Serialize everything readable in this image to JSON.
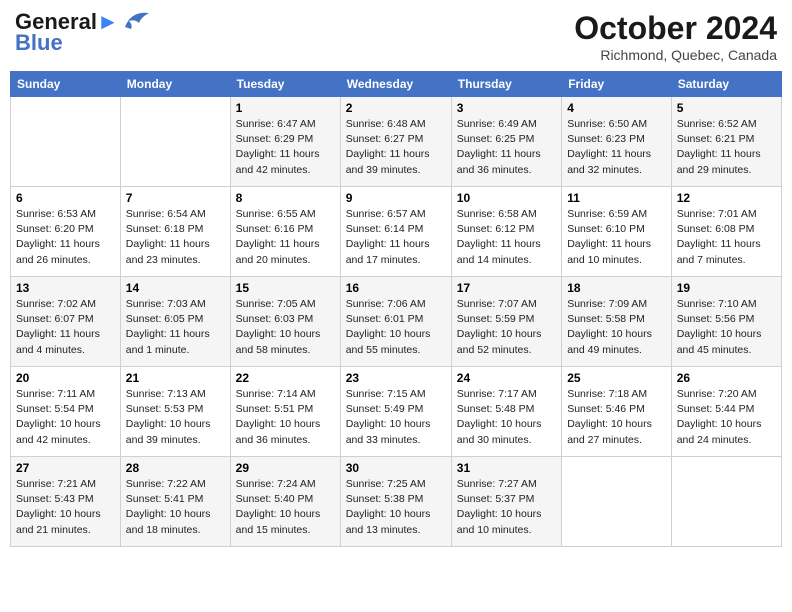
{
  "header": {
    "logo_line1": "General",
    "logo_line2": "Blue",
    "month": "October 2024",
    "location": "Richmond, Quebec, Canada"
  },
  "weekdays": [
    "Sunday",
    "Monday",
    "Tuesday",
    "Wednesday",
    "Thursday",
    "Friday",
    "Saturday"
  ],
  "weeks": [
    [
      {
        "day": "",
        "sunrise": "",
        "sunset": "",
        "daylight": ""
      },
      {
        "day": "",
        "sunrise": "",
        "sunset": "",
        "daylight": ""
      },
      {
        "day": "1",
        "sunrise": "Sunrise: 6:47 AM",
        "sunset": "Sunset: 6:29 PM",
        "daylight": "Daylight: 11 hours and 42 minutes."
      },
      {
        "day": "2",
        "sunrise": "Sunrise: 6:48 AM",
        "sunset": "Sunset: 6:27 PM",
        "daylight": "Daylight: 11 hours and 39 minutes."
      },
      {
        "day": "3",
        "sunrise": "Sunrise: 6:49 AM",
        "sunset": "Sunset: 6:25 PM",
        "daylight": "Daylight: 11 hours and 36 minutes."
      },
      {
        "day": "4",
        "sunrise": "Sunrise: 6:50 AM",
        "sunset": "Sunset: 6:23 PM",
        "daylight": "Daylight: 11 hours and 32 minutes."
      },
      {
        "day": "5",
        "sunrise": "Sunrise: 6:52 AM",
        "sunset": "Sunset: 6:21 PM",
        "daylight": "Daylight: 11 hours and 29 minutes."
      }
    ],
    [
      {
        "day": "6",
        "sunrise": "Sunrise: 6:53 AM",
        "sunset": "Sunset: 6:20 PM",
        "daylight": "Daylight: 11 hours and 26 minutes."
      },
      {
        "day": "7",
        "sunrise": "Sunrise: 6:54 AM",
        "sunset": "Sunset: 6:18 PM",
        "daylight": "Daylight: 11 hours and 23 minutes."
      },
      {
        "day": "8",
        "sunrise": "Sunrise: 6:55 AM",
        "sunset": "Sunset: 6:16 PM",
        "daylight": "Daylight: 11 hours and 20 minutes."
      },
      {
        "day": "9",
        "sunrise": "Sunrise: 6:57 AM",
        "sunset": "Sunset: 6:14 PM",
        "daylight": "Daylight: 11 hours and 17 minutes."
      },
      {
        "day": "10",
        "sunrise": "Sunrise: 6:58 AM",
        "sunset": "Sunset: 6:12 PM",
        "daylight": "Daylight: 11 hours and 14 minutes."
      },
      {
        "day": "11",
        "sunrise": "Sunrise: 6:59 AM",
        "sunset": "Sunset: 6:10 PM",
        "daylight": "Daylight: 11 hours and 10 minutes."
      },
      {
        "day": "12",
        "sunrise": "Sunrise: 7:01 AM",
        "sunset": "Sunset: 6:08 PM",
        "daylight": "Daylight: 11 hours and 7 minutes."
      }
    ],
    [
      {
        "day": "13",
        "sunrise": "Sunrise: 7:02 AM",
        "sunset": "Sunset: 6:07 PM",
        "daylight": "Daylight: 11 hours and 4 minutes."
      },
      {
        "day": "14",
        "sunrise": "Sunrise: 7:03 AM",
        "sunset": "Sunset: 6:05 PM",
        "daylight": "Daylight: 11 hours and 1 minute."
      },
      {
        "day": "15",
        "sunrise": "Sunrise: 7:05 AM",
        "sunset": "Sunset: 6:03 PM",
        "daylight": "Daylight: 10 hours and 58 minutes."
      },
      {
        "day": "16",
        "sunrise": "Sunrise: 7:06 AM",
        "sunset": "Sunset: 6:01 PM",
        "daylight": "Daylight: 10 hours and 55 minutes."
      },
      {
        "day": "17",
        "sunrise": "Sunrise: 7:07 AM",
        "sunset": "Sunset: 5:59 PM",
        "daylight": "Daylight: 10 hours and 52 minutes."
      },
      {
        "day": "18",
        "sunrise": "Sunrise: 7:09 AM",
        "sunset": "Sunset: 5:58 PM",
        "daylight": "Daylight: 10 hours and 49 minutes."
      },
      {
        "day": "19",
        "sunrise": "Sunrise: 7:10 AM",
        "sunset": "Sunset: 5:56 PM",
        "daylight": "Daylight: 10 hours and 45 minutes."
      }
    ],
    [
      {
        "day": "20",
        "sunrise": "Sunrise: 7:11 AM",
        "sunset": "Sunset: 5:54 PM",
        "daylight": "Daylight: 10 hours and 42 minutes."
      },
      {
        "day": "21",
        "sunrise": "Sunrise: 7:13 AM",
        "sunset": "Sunset: 5:53 PM",
        "daylight": "Daylight: 10 hours and 39 minutes."
      },
      {
        "day": "22",
        "sunrise": "Sunrise: 7:14 AM",
        "sunset": "Sunset: 5:51 PM",
        "daylight": "Daylight: 10 hours and 36 minutes."
      },
      {
        "day": "23",
        "sunrise": "Sunrise: 7:15 AM",
        "sunset": "Sunset: 5:49 PM",
        "daylight": "Daylight: 10 hours and 33 minutes."
      },
      {
        "day": "24",
        "sunrise": "Sunrise: 7:17 AM",
        "sunset": "Sunset: 5:48 PM",
        "daylight": "Daylight: 10 hours and 30 minutes."
      },
      {
        "day": "25",
        "sunrise": "Sunrise: 7:18 AM",
        "sunset": "Sunset: 5:46 PM",
        "daylight": "Daylight: 10 hours and 27 minutes."
      },
      {
        "day": "26",
        "sunrise": "Sunrise: 7:20 AM",
        "sunset": "Sunset: 5:44 PM",
        "daylight": "Daylight: 10 hours and 24 minutes."
      }
    ],
    [
      {
        "day": "27",
        "sunrise": "Sunrise: 7:21 AM",
        "sunset": "Sunset: 5:43 PM",
        "daylight": "Daylight: 10 hours and 21 minutes."
      },
      {
        "day": "28",
        "sunrise": "Sunrise: 7:22 AM",
        "sunset": "Sunset: 5:41 PM",
        "daylight": "Daylight: 10 hours and 18 minutes."
      },
      {
        "day": "29",
        "sunrise": "Sunrise: 7:24 AM",
        "sunset": "Sunset: 5:40 PM",
        "daylight": "Daylight: 10 hours and 15 minutes."
      },
      {
        "day": "30",
        "sunrise": "Sunrise: 7:25 AM",
        "sunset": "Sunset: 5:38 PM",
        "daylight": "Daylight: 10 hours and 13 minutes."
      },
      {
        "day": "31",
        "sunrise": "Sunrise: 7:27 AM",
        "sunset": "Sunset: 5:37 PM",
        "daylight": "Daylight: 10 hours and 10 minutes."
      },
      {
        "day": "",
        "sunrise": "",
        "sunset": "",
        "daylight": ""
      },
      {
        "day": "",
        "sunrise": "",
        "sunset": "",
        "daylight": ""
      }
    ]
  ]
}
